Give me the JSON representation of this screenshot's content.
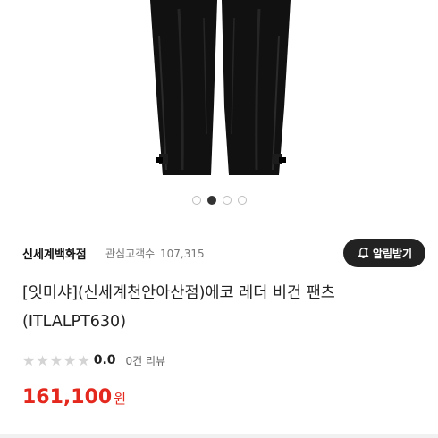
{
  "gallery": {
    "image_alt": "black leather pants product photo",
    "page_count": 4,
    "active_index": 1
  },
  "store": {
    "name": "신세계백화점",
    "follower_label": "관심고객수",
    "follower_count": "107,315",
    "alarm_button_label": "알림받기",
    "alarm_icon": "bell-plus-icon"
  },
  "product": {
    "title": "[잇미샤](신세계천안아산점)에코 레더 비건 팬츠 (ITLALPT630)"
  },
  "rating": {
    "stars_filled": 0,
    "stars_total": 5,
    "value": "0.0",
    "review_count_label": "0건 리뷰",
    "star_color": "#d4d4d4"
  },
  "price": {
    "amount": "161,100",
    "currency": "원",
    "color": "#e4281e"
  }
}
